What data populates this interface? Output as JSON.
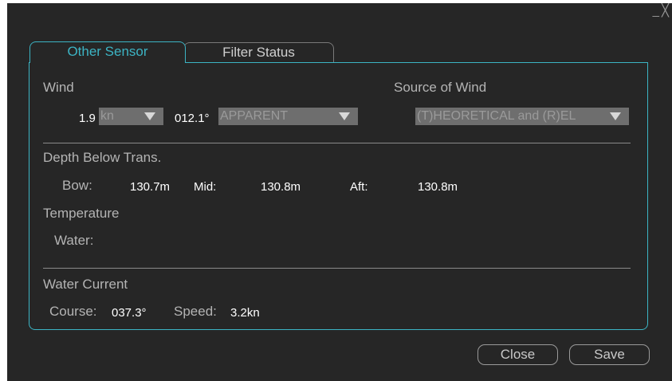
{
  "window": {
    "minimize": "_",
    "close": "╳"
  },
  "tabs": [
    {
      "label": "Other Sensor",
      "active": true
    },
    {
      "label": "Filter Status",
      "active": false
    }
  ],
  "wind": {
    "heading": "Wind",
    "speed": "1.9",
    "speed_unit": "kn",
    "direction": "012.1°",
    "mode": "APPARENT"
  },
  "source_of_wind": {
    "heading": "Source of Wind",
    "value": "(T)HEORETICAL and (R)EL"
  },
  "depth": {
    "heading": "Depth Below Trans.",
    "bow_label": "Bow:",
    "bow_value": "130.7m",
    "mid_label": "Mid:",
    "mid_value": "130.8m",
    "aft_label": "Aft:",
    "aft_value": "130.8m"
  },
  "temperature": {
    "heading": "Temperature",
    "water_label": "Water:",
    "water_value": ""
  },
  "water_current": {
    "heading": "Water Current",
    "course_label": "Course:",
    "course_value": "037.3°",
    "speed_label": "Speed:",
    "speed_value": "3.2kn"
  },
  "buttons": {
    "close": "Close",
    "save": "Save"
  },
  "colors": {
    "accent": "#3cb4c4",
    "background": "#262626",
    "dropdown": "#6e6e6e"
  }
}
